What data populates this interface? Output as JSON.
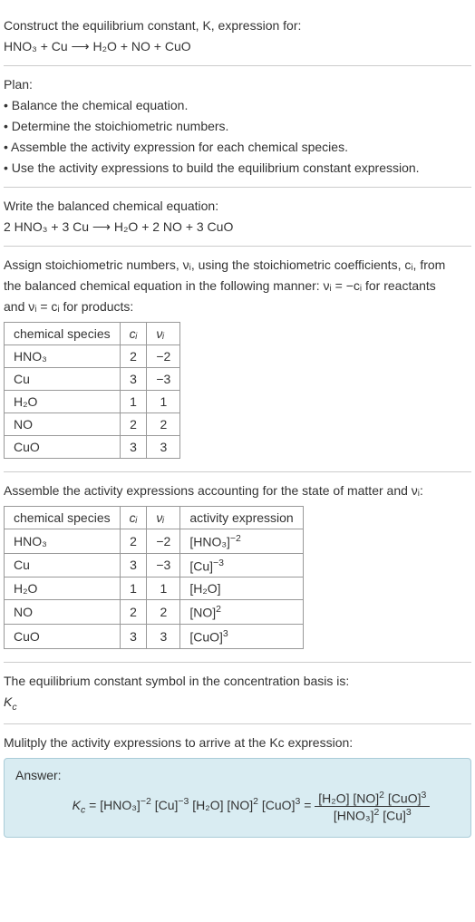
{
  "sec1": {
    "l1": "Construct the equilibrium constant, K, expression for:",
    "l2": "HNO₃ + Cu ⟶ H₂O + NO + CuO"
  },
  "sec2": {
    "l1": "Plan:",
    "l2": "• Balance the chemical equation.",
    "l3": "• Determine the stoichiometric numbers.",
    "l4": "• Assemble the activity expression for each chemical species.",
    "l5": "• Use the activity expressions to build the equilibrium constant expression."
  },
  "sec3": {
    "l1": "Write the balanced chemical equation:",
    "l2": "2 HNO₃ + 3 Cu ⟶ H₂O + 2 NO + 3 CuO"
  },
  "sec4": {
    "intro1": "Assign stoichiometric numbers, νᵢ, using the stoichiometric coefficients, cᵢ, from",
    "intro2": "the balanced chemical equation in the following manner: νᵢ = −cᵢ for reactants",
    "intro3": "and νᵢ = cᵢ for products:",
    "headers": {
      "h1": "chemical species",
      "h2": "cᵢ",
      "h3": "νᵢ"
    },
    "rows": [
      {
        "sp": "HNO₃",
        "c": "2",
        "v": "−2"
      },
      {
        "sp": "Cu",
        "c": "3",
        "v": "−3"
      },
      {
        "sp": "H₂O",
        "c": "1",
        "v": "1"
      },
      {
        "sp": "NO",
        "c": "2",
        "v": "2"
      },
      {
        "sp": "CuO",
        "c": "3",
        "v": "3"
      }
    ]
  },
  "sec5": {
    "intro": "Assemble the activity expressions accounting for the state of matter and νᵢ:",
    "headers": {
      "h1": "chemical species",
      "h2": "cᵢ",
      "h3": "νᵢ",
      "h4": "activity expression"
    },
    "rows": [
      {
        "sp": "HNO₃",
        "c": "2",
        "v": "−2",
        "a_base": "[HNO₃]",
        "a_sup": "−2"
      },
      {
        "sp": "Cu",
        "c": "3",
        "v": "−3",
        "a_base": "[Cu]",
        "a_sup": "−3"
      },
      {
        "sp": "H₂O",
        "c": "1",
        "v": "1",
        "a_base": "[H₂O]",
        "a_sup": ""
      },
      {
        "sp": "NO",
        "c": "2",
        "v": "2",
        "a_base": "[NO]",
        "a_sup": "2"
      },
      {
        "sp": "CuO",
        "c": "3",
        "v": "3",
        "a_base": "[CuO]",
        "a_sup": "3"
      }
    ]
  },
  "sec6": {
    "l1": "The equilibrium constant symbol in the concentration basis is:",
    "l2": "K",
    "l2sub": "c"
  },
  "sec7": {
    "intro": "Mulitply the activity expressions to arrive at the Kc expression:",
    "answerLabel": "Answer:",
    "kc": "K",
    "kcsub": "c",
    "eq": " = ",
    "t1b": "[HNO₃]",
    "t1s": "−2",
    "t2b": " [Cu]",
    "t2s": "−3",
    "t3b": " [H₂O]",
    "t4b": " [NO]",
    "t4s": "2",
    "t5b": " [CuO]",
    "t5s": "3",
    "eq2": " = ",
    "n1b": "[H₂O]",
    "n2b": " [NO]",
    "n2s": "2",
    "n3b": " [CuO]",
    "n3s": "3",
    "d1b": "[HNO₃]",
    "d1s": "2",
    "d2b": " [Cu]",
    "d2s": "3"
  },
  "chart_data": {
    "type": "table",
    "tables": [
      {
        "title": "Stoichiometric numbers",
        "columns": [
          "chemical species",
          "c_i",
          "ν_i"
        ],
        "rows": [
          [
            "HNO3",
            2,
            -2
          ],
          [
            "Cu",
            3,
            -3
          ],
          [
            "H2O",
            1,
            1
          ],
          [
            "NO",
            2,
            2
          ],
          [
            "CuO",
            3,
            3
          ]
        ]
      },
      {
        "title": "Activity expressions",
        "columns": [
          "chemical species",
          "c_i",
          "ν_i",
          "activity expression"
        ],
        "rows": [
          [
            "HNO3",
            2,
            -2,
            "[HNO3]^-2"
          ],
          [
            "Cu",
            3,
            -3,
            "[Cu]^-3"
          ],
          [
            "H2O",
            1,
            1,
            "[H2O]"
          ],
          [
            "NO",
            2,
            2,
            "[NO]^2"
          ],
          [
            "CuO",
            3,
            3,
            "[CuO]^3"
          ]
        ]
      }
    ]
  }
}
